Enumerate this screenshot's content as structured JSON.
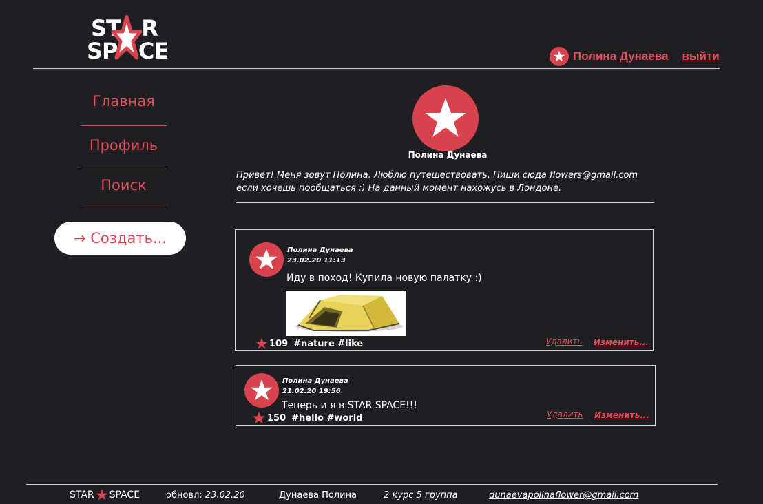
{
  "header": {
    "logo_row1": "ST  R",
    "logo_row2": "SP  CE",
    "user_name": "Полина Дунаева",
    "logout_label": "выйти"
  },
  "sidebar": {
    "items": [
      {
        "label": "Главная"
      },
      {
        "label": "Профиль"
      },
      {
        "label": "Поиск"
      }
    ],
    "create_label": "→ Создать..."
  },
  "profile": {
    "name": "Полина Дунаева",
    "bio_line1": "Привет! Меня зовут Полина. Люблю путешествовать. Пиши сюда flowers@gmail.com",
    "bio_line2": "если хочешь пообщаться :) На данный момент нахожусь в Лондоне."
  },
  "posts": [
    {
      "author": "Полина Дунаева",
      "date": "23.02.20 11:13",
      "text": "Иду в поход! Купила новую палатку :)",
      "likes": "109",
      "tags": "#nature #like",
      "delete_label": "Удалить",
      "edit_label": "Изменить..."
    },
    {
      "author": "Полина Дунаева",
      "date": "21.02.20 19:56",
      "text": "Теперь и я в STAR SPACE!!!",
      "likes": "150",
      "tags": "#hello #world",
      "delete_label": "Удалить",
      "edit_label": "Изменить..."
    }
  ],
  "footer": {
    "logo_left": "STAR",
    "logo_right": "SPACE",
    "updated_label": "обновл:",
    "updated_date": "23.02.20",
    "author": "Дунаева Полина",
    "group": "2 курс 5 группа",
    "email": "dunaevapolinaflower@gmail.com"
  },
  "colors": {
    "accent": "#d9434e",
    "background": "#1f1e22"
  }
}
